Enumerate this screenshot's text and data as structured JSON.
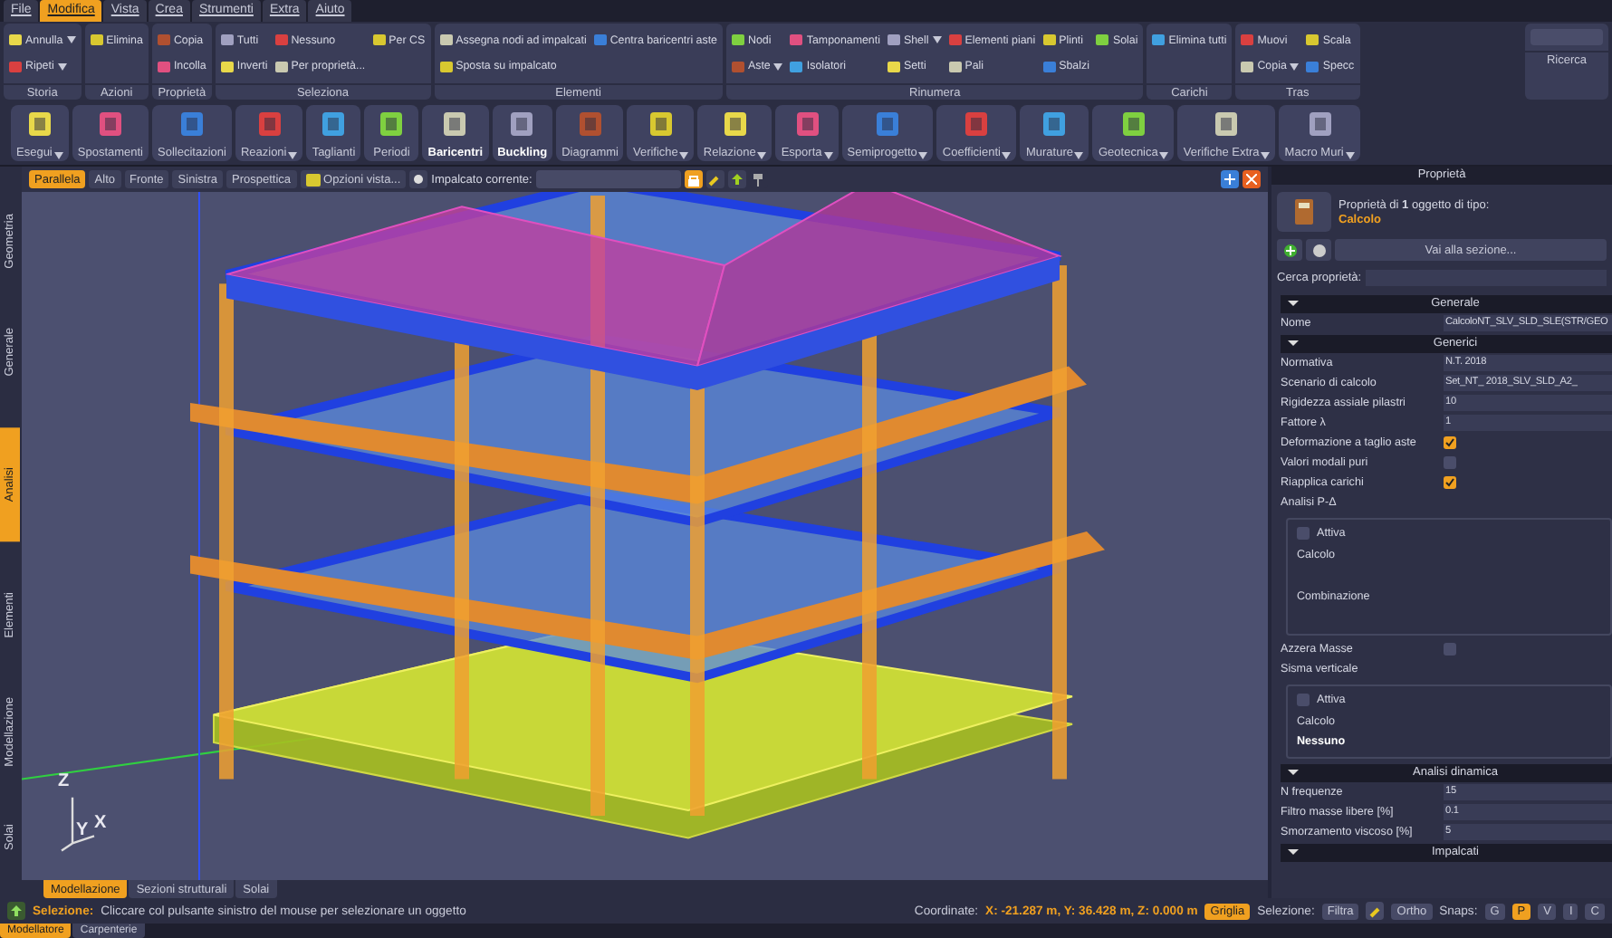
{
  "menu": [
    {
      "label": "File",
      "selected": false
    },
    {
      "label": "Modifica",
      "selected": true
    },
    {
      "label": "Vista",
      "selected": false
    },
    {
      "label": "Crea",
      "selected": false
    },
    {
      "label": "Strumenti",
      "selected": false
    },
    {
      "label": "Extra",
      "selected": false
    },
    {
      "label": "Aiuto",
      "selected": false
    }
  ],
  "ribbon": [
    {
      "kind": "buttons",
      "title": "Storia",
      "items": [
        {
          "label": "Annulla",
          "dropdown": true
        },
        {
          "label": "Ripeti",
          "dropdown": true
        }
      ]
    },
    {
      "kind": "buttons",
      "title": "Azioni",
      "items": [
        {
          "label": "Elimina"
        }
      ]
    },
    {
      "kind": "buttons",
      "title": "Proprietà",
      "items": [
        {
          "label": "Copia"
        },
        {
          "label": "Incolla"
        }
      ]
    },
    {
      "kind": "buttons",
      "title": "Seleziona",
      "items": [
        {
          "label": "Tutti"
        },
        {
          "label": "Inverti"
        },
        {
          "label": "Nessuno"
        },
        {
          "label": "Per proprietà..."
        },
        {
          "label": "Per CS"
        }
      ]
    },
    {
      "kind": "buttons",
      "title": "Elementi",
      "items": [
        {
          "label": "Assegna nodi ad impalcati"
        },
        {
          "label": "Sposta su impalcato"
        },
        {
          "label": "Centra baricentri aste"
        }
      ]
    },
    {
      "kind": "buttons",
      "title": "Rinumera",
      "items": [
        {
          "label": "Nodi"
        },
        {
          "label": "Aste",
          "dropdown": true
        },
        {
          "label": "Tamponamenti"
        },
        {
          "label": "Isolatori"
        },
        {
          "label": "Shell",
          "dropdown": true
        },
        {
          "label": "Setti"
        },
        {
          "label": "Elementi piani"
        },
        {
          "label": "Pali"
        },
        {
          "label": "Plinti"
        },
        {
          "label": "Sbalzi"
        },
        {
          "label": "Solai"
        }
      ]
    },
    {
      "kind": "buttons",
      "title": "Carichi",
      "items": [
        {
          "label": "Elimina tutti"
        }
      ]
    },
    {
      "kind": "buttons",
      "title": "Tras",
      "items": [
        {
          "label": "Muovi"
        },
        {
          "label": "Copia",
          "dropdown": true
        },
        {
          "label": "Scala"
        },
        {
          "label": "Specc"
        }
      ]
    },
    {
      "kind": "search",
      "title": "Ricerca"
    }
  ],
  "toolbar": [
    {
      "label": "Esegui",
      "dropdown": true,
      "active": false
    },
    {
      "label": "Spostamenti",
      "active": false
    },
    {
      "label": "Sollecitazioni",
      "active": false
    },
    {
      "label": "Reazioni",
      "dropdown": true,
      "active": false
    },
    {
      "label": "Taglianti",
      "active": false
    },
    {
      "label": "Periodi",
      "active": false
    },
    {
      "label": "Baricentri",
      "active": true
    },
    {
      "label": "Buckling",
      "active": true
    },
    {
      "label": "Diagrammi",
      "active": false
    },
    {
      "label": "Verifiche",
      "dropdown": true,
      "active": false
    },
    {
      "label": "Relazione",
      "dropdown": true,
      "active": false
    },
    {
      "label": "Esporta",
      "dropdown": true,
      "active": false
    },
    {
      "label": "Semiprogetto",
      "dropdown": true,
      "active": false
    },
    {
      "label": "Coefficienti",
      "dropdown": true,
      "active": false
    },
    {
      "label": "Murature",
      "dropdown": true,
      "active": false
    },
    {
      "label": "Geotecnica",
      "dropdown": true,
      "active": false
    },
    {
      "label": "Verifiche Extra",
      "dropdown": true,
      "active": false
    },
    {
      "label": "Macro Muri",
      "dropdown": true,
      "active": false
    }
  ],
  "side_tabs": [
    {
      "label": "Geometria",
      "selected": false
    },
    {
      "label": "Generale",
      "selected": false
    },
    {
      "label": "Analisi",
      "selected": true
    },
    {
      "label": "Elementi",
      "selected": false
    },
    {
      "label": "Modellazione",
      "selected": false
    },
    {
      "label": "Solai",
      "selected": false
    }
  ],
  "view_toolbar": {
    "views": [
      {
        "label": "Parallela",
        "selected": true
      },
      {
        "label": "Alto",
        "selected": false
      },
      {
        "label": "Fronte",
        "selected": false
      },
      {
        "label": "Sinistra",
        "selected": false
      },
      {
        "label": "Prospettica",
        "selected": false
      }
    ],
    "options": "Opzioni vista...",
    "floor_label": "Impalcato corrente:",
    "lock_on": true
  },
  "axis_labels": {
    "z": "Z",
    "y": "Y",
    "x": "X"
  },
  "view_tabs": [
    {
      "label": "Modellazione",
      "selected": true
    },
    {
      "label": "Sezioni strutturali",
      "selected": false
    },
    {
      "label": "Solai",
      "selected": false
    }
  ],
  "properties": {
    "title": "Proprietà",
    "summary": "Proprietà di **1** oggetto di tipo:",
    "type": "Calcolo",
    "goto": "Vai alla sezione...",
    "search_label": "Cerca proprietà:",
    "rows": [
      {
        "kind": "section",
        "label": "Generale"
      },
      {
        "kind": "field",
        "label": "Nome",
        "value": "CalcoloNT_SLV_SLD_SLE(STR/GEO"
      },
      {
        "kind": "section",
        "label": "Generici"
      },
      {
        "kind": "field",
        "label": "Normativa",
        "value": "N.T. 2018"
      },
      {
        "kind": "field",
        "label": "Scenario di calcolo",
        "value": "Set_NT_ 2018_SLV_SLD_A2_"
      },
      {
        "kind": "field",
        "label": "Rigidezza assiale pilastri",
        "value": "10"
      },
      {
        "kind": "field",
        "label": "Fattore λ",
        "value": "1"
      },
      {
        "kind": "check",
        "label": "Deformazione a taglio aste",
        "checked": true
      },
      {
        "kind": "check",
        "label": "Valori modali puri",
        "checked": false
      },
      {
        "kind": "check",
        "label": "Riapplica carichi",
        "checked": true
      },
      {
        "kind": "label",
        "label": "Analisi P-Δ"
      },
      {
        "kind": "group",
        "children": [
          {
            "kind": "check",
            "label": "Attiva",
            "checked": false
          },
          {
            "kind": "label",
            "label": "Calcolo"
          },
          {
            "kind": "spacer"
          },
          {
            "kind": "label",
            "label": "Combinazione"
          },
          {
            "kind": "spacer"
          }
        ]
      },
      {
        "kind": "check",
        "label": "Azzera Masse",
        "checked": false
      },
      {
        "kind": "label",
        "label": "Sisma verticale"
      },
      {
        "kind": "group",
        "children": [
          {
            "kind": "check",
            "label": "Attiva",
            "checked": false
          },
          {
            "kind": "label",
            "label": "Calcolo"
          },
          {
            "kind": "value",
            "label": "Nessuno"
          }
        ]
      },
      {
        "kind": "section",
        "label": "Analisi dinamica"
      },
      {
        "kind": "field",
        "label": "N frequenze",
        "value": "15"
      },
      {
        "kind": "field",
        "label": "Filtro masse libere [%]",
        "value": "0.1"
      },
      {
        "kind": "field",
        "label": "Smorzamento viscoso [%]",
        "value": "5"
      },
      {
        "kind": "section",
        "label": "Impalcati"
      }
    ]
  },
  "status_bar": {
    "label": "Selezione:",
    "message": "Cliccare col pulsante sinistro del mouse per selezionare un oggetto",
    "coord_label": "Coordinate:",
    "coords": "X: -21.287 m, Y: 36.428 m, Z: 0.000 m",
    "grid": {
      "label": "Griglia",
      "on": true
    },
    "selection_label": "Selezione:",
    "filter": "Filtra",
    "ortho": {
      "label": "Ortho",
      "on": false
    },
    "snaps_label": "Snaps:",
    "snaps": [
      {
        "label": "G",
        "selected": false
      },
      {
        "label": "P",
        "selected": true
      },
      {
        "label": "V",
        "selected": false
      },
      {
        "label": "I",
        "selected": false
      },
      {
        "label": "C",
        "selected": false
      }
    ]
  },
  "app_tabs": [
    {
      "label": "Modellatore",
      "selected": true
    },
    {
      "label": "Carpenterie",
      "selected": false
    }
  ]
}
